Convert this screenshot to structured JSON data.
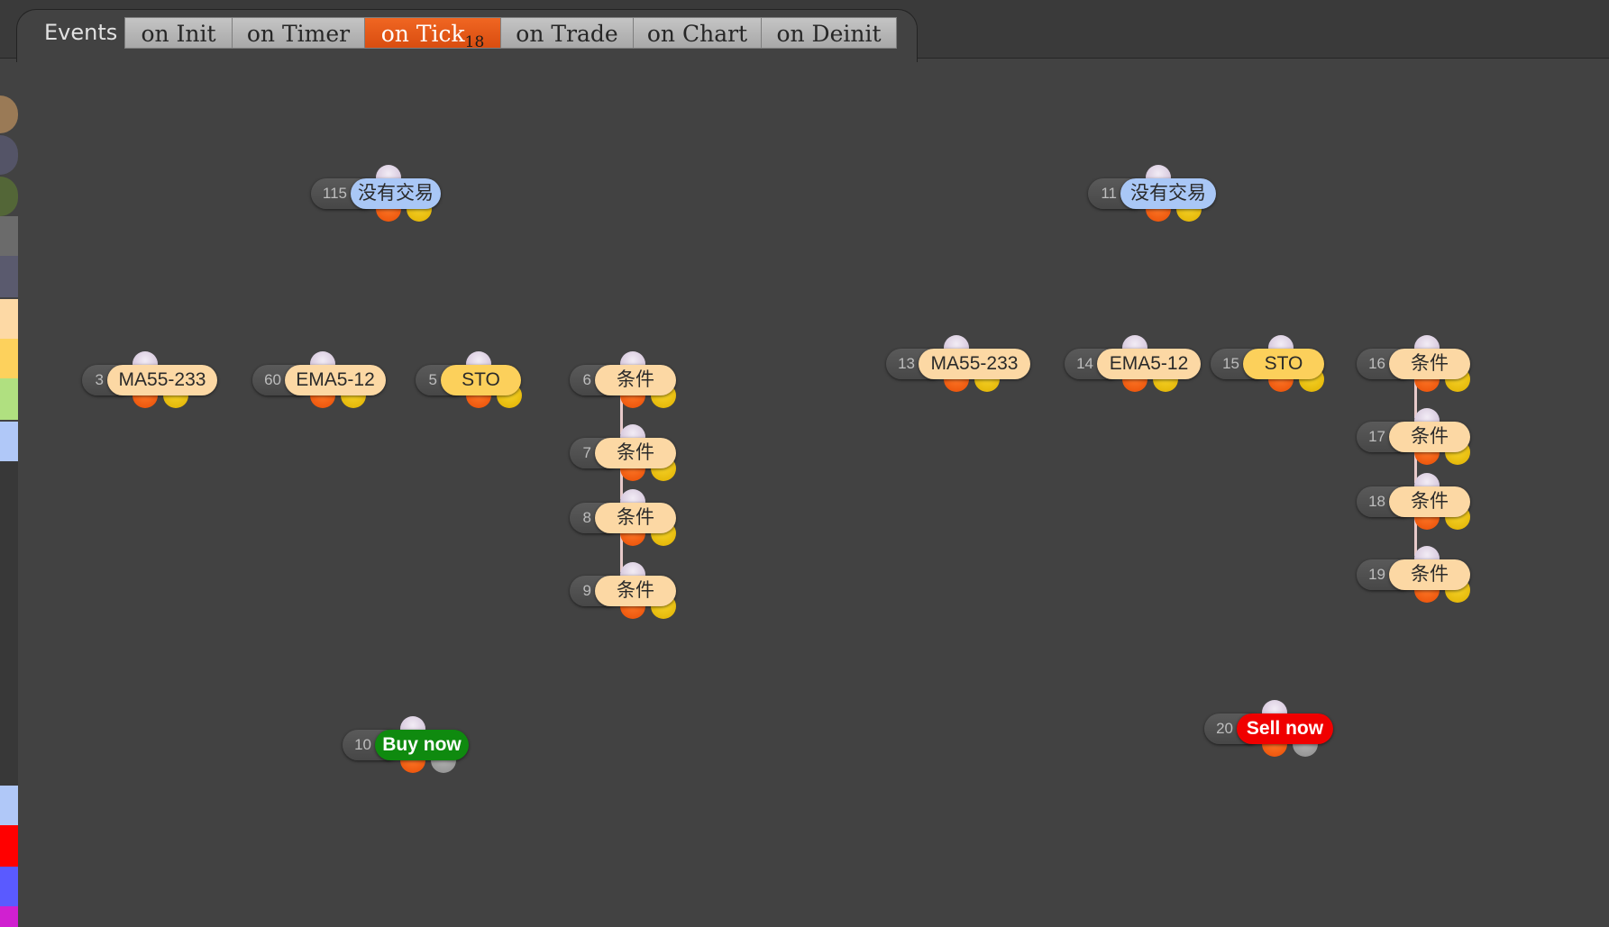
{
  "header": {
    "events_label": "Events",
    "tabs": [
      {
        "label": "on Init",
        "active": false
      },
      {
        "label": "on Timer",
        "active": false
      },
      {
        "label": "on Tick",
        "badge": "18",
        "active": true
      },
      {
        "label": "on Trade",
        "active": false
      },
      {
        "label": "on Chart",
        "active": false
      },
      {
        "label": "on Deinit",
        "active": false
      }
    ]
  },
  "palette": [
    "#9a7a56",
    "#545467",
    "#536637",
    "#6b6b6b",
    "#5a5a6e",
    "#fdd9a5",
    "#fdd15c",
    "#b0e080",
    "#b0c8f8",
    "#383838",
    "#b0c8f8",
    "#ff0000",
    "#5a5aff",
    "#d020d0"
  ],
  "nodes": [
    {
      "id": "115",
      "label": "没有交易",
      "color": "#a9c7f6",
      "second_out": "yellow"
    },
    {
      "id": "3",
      "label": "MA55-233",
      "color": "#fcd8a4",
      "second_out": "yellow"
    },
    {
      "id": "60",
      "label": "EMA5-12",
      "color": "#fcd8a4",
      "second_out": "yellow"
    },
    {
      "id": "5",
      "label": "STO",
      "color": "#fcd05b",
      "second_out": "yellow"
    },
    {
      "id": "6",
      "label": "条件",
      "color": "#fcd8a4",
      "second_out": "yellow"
    },
    {
      "id": "7",
      "label": "条件",
      "color": "#fcd8a4",
      "second_out": "yellow"
    },
    {
      "id": "8",
      "label": "条件",
      "color": "#fcd8a4",
      "second_out": "yellow"
    },
    {
      "id": "9",
      "label": "条件",
      "color": "#fcd8a4",
      "second_out": "yellow"
    },
    {
      "id": "10",
      "label": "Buy now",
      "color": "#0f8a0f",
      "text_color": "#ffffff",
      "second_out": "gray"
    },
    {
      "id": "11",
      "label": "没有交易",
      "color": "#a9c7f6",
      "second_out": "yellow"
    },
    {
      "id": "13",
      "label": "MA55-233",
      "color": "#fcd8a4",
      "second_out": "yellow"
    },
    {
      "id": "14",
      "label": "EMA5-12",
      "color": "#fcd8a4",
      "second_out": "yellow"
    },
    {
      "id": "15",
      "label": "STO",
      "color": "#fcd05b",
      "second_out": "yellow"
    },
    {
      "id": "16",
      "label": "条件",
      "color": "#fcd8a4",
      "second_out": "yellow"
    },
    {
      "id": "17",
      "label": "条件",
      "color": "#fcd8a4",
      "second_out": "yellow"
    },
    {
      "id": "18",
      "label": "条件",
      "color": "#fcd8a4",
      "second_out": "yellow"
    },
    {
      "id": "19",
      "label": "条件",
      "color": "#fcd8a4",
      "second_out": "yellow"
    },
    {
      "id": "20",
      "label": "Sell now",
      "color": "#f00000",
      "text_color": "#ffffff",
      "second_out": "gray"
    }
  ]
}
